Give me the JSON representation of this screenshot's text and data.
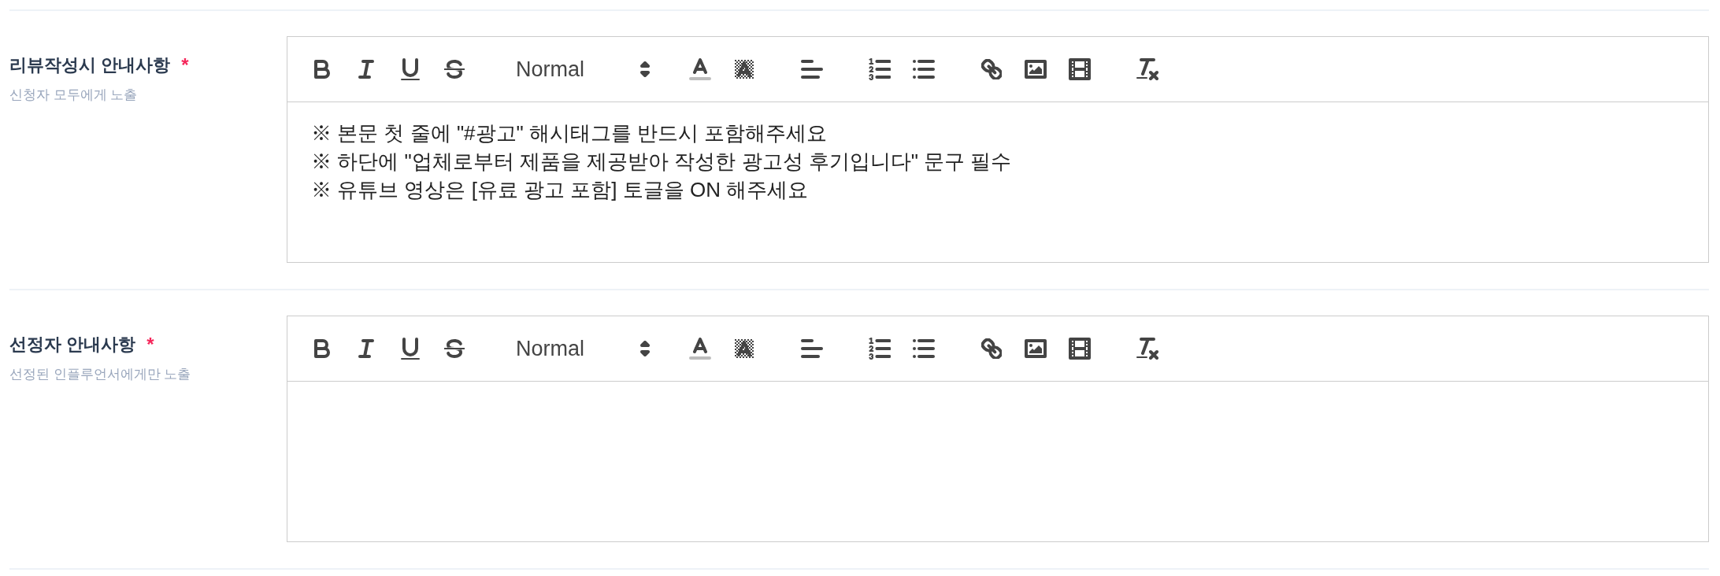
{
  "sections": [
    {
      "label": "리뷰작성시 안내사항",
      "required_mark": "*",
      "hint": "신청자 모두에게 노출",
      "editor": {
        "toolbar": {
          "format": "Normal"
        },
        "paragraphs": [
          "※ 본문 첫 줄에 \"#광고\" 해시태그를 반드시 포함해주세요",
          "※ 하단에 \"업체로부터 제품을 제공받아 작성한 광고성 후기입니다\" 문구 필수",
          "※ 유튜브 영상은 [유료 광고 포함] 토글을 ON 해주세요"
        ]
      }
    },
    {
      "label": "선정자 안내사항",
      "required_mark": "*",
      "hint": "선정된 인플루언서에게만 노출",
      "editor": {
        "toolbar": {
          "format": "Normal"
        }
      }
    }
  ]
}
